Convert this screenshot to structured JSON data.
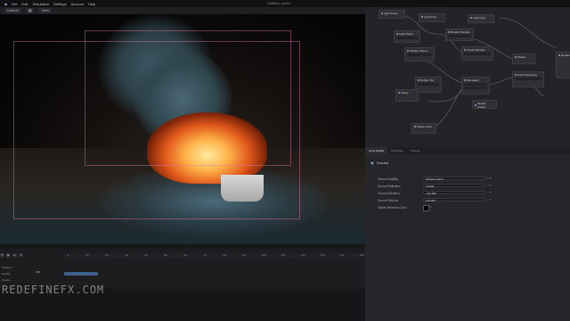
{
  "menu": {
    "items": [
      "File",
      "Edit",
      "Simulation",
      "Settings",
      "Account",
      "Help"
    ],
    "title": "Untitled_scene"
  },
  "toolbar": {
    "buttons": [
      "Default",
      "",
      "View"
    ]
  },
  "timeline": {
    "ticks": [
      "0",
      "10",
      "20",
      "30",
      "40",
      "50",
      "60",
      "70",
      "80",
      "90",
      "100",
      "110",
      "120",
      "130",
      "140",
      "150"
    ],
    "frame_field": "240",
    "rows": [
      "Viewport",
      "Emitter",
      "Render"
    ]
  },
  "watermark": "REDEFINEFX.COM",
  "graph": {
    "nodes": [
      {
        "label": "Light Scene"
      },
      {
        "label": "Light Point"
      },
      {
        "label": "Light Point"
      },
      {
        "label": "Render Sampler"
      },
      {
        "label": "Light Object"
      },
      {
        "label": "Shader Volume"
      },
      {
        "label": "Ocean Sampler"
      },
      {
        "label": "Shader"
      },
      {
        "label": "Emitter Obj"
      },
      {
        "label": "Simulation"
      },
      {
        "label": "Solver"
      },
      {
        "label": "Render Output"
      },
      {
        "label": "Shape Voxel"
      },
      {
        "label": "Post Processing"
      },
      {
        "label": "Render"
      }
    ]
  },
  "properties": {
    "tabs": [
      "Node Details",
      "Properties",
      "Presets"
    ],
    "header": "Ground",
    "rows": [
      {
        "label": "Ground Visibility",
        "value": "Shadow Catch"
      },
      {
        "label": "Ground Reflection",
        "value": "0.0000"
      },
      {
        "label": "Ground Elevation",
        "value": "-132.568"
      },
      {
        "label": "Ground Shadow",
        "value": "125.000"
      },
      {
        "label": "Visible Reflection Color",
        "value": ""
      }
    ]
  }
}
